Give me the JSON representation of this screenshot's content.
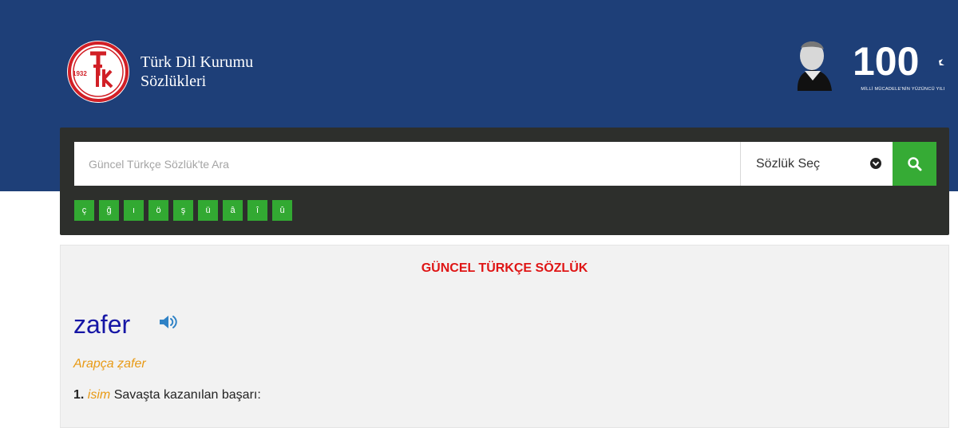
{
  "header": {
    "logo_year": "1932",
    "brand_line1": "Türk Dil Kurumu",
    "brand_line2": "Sözlükleri",
    "centennial_number": "100",
    "centennial_caption": "MİLLİ MÜCADELE'NİN YÜZÜNCÜ YILI"
  },
  "search": {
    "placeholder": "Güncel Türkçe Sözlük'te Ara",
    "dictionary_select_label": "Sözlük Seç",
    "special_chars": [
      "ç",
      "ğ",
      "ı",
      "ö",
      "ş",
      "ü",
      "â",
      "î",
      "û"
    ]
  },
  "result": {
    "dictionary_title": "GÜNCEL TÜRKÇE SÖZLÜK",
    "headword": "zafer",
    "origin": "Arapça ẓafer",
    "meaning_number": "1.",
    "meaning_pos": "isim",
    "meaning_text": "Savaşta kazanılan başarı:"
  },
  "colors": {
    "header_blue": "#1e3f78",
    "panel_dark": "#2d2f2c",
    "accent_green": "#36ab35",
    "title_red": "#df1515",
    "headword_blue": "#1616a5",
    "origin_orange": "#e89a15"
  }
}
